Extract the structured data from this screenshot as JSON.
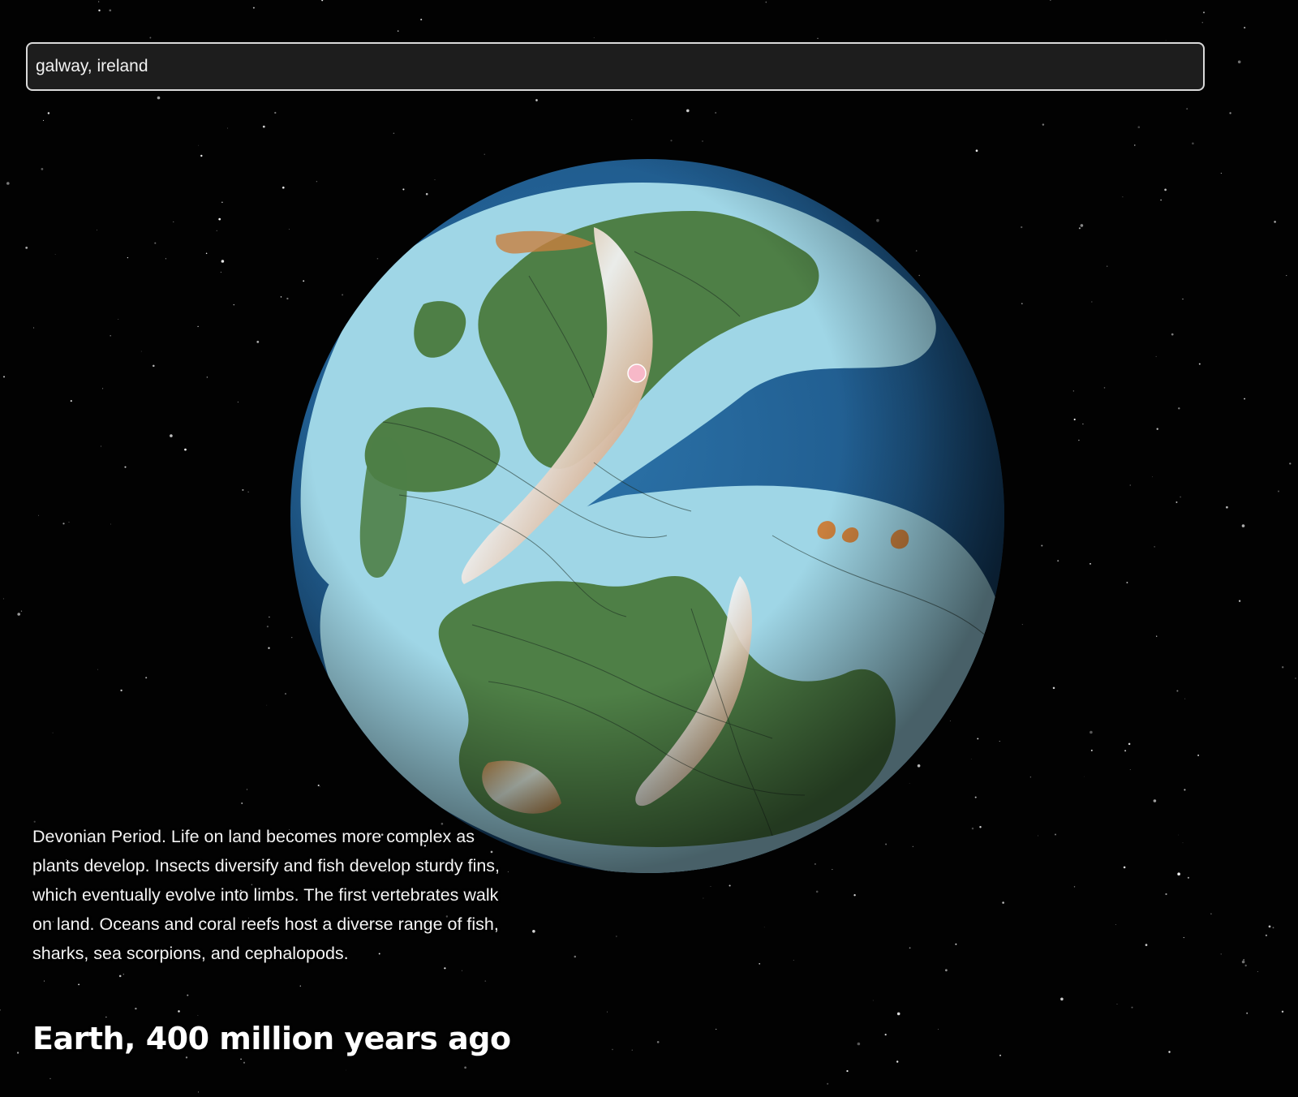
{
  "search": {
    "value": "galway, ireland",
    "placeholder": ""
  },
  "globe": {
    "marker_label": "",
    "colors": {
      "deep_ocean": "#1f5a8c",
      "shallow_shelf": "#9fd6e6",
      "lowland": "#4e7f46",
      "upland": "#c9803e",
      "peak": "#f2f2f2",
      "marker": "#f7b8c8"
    }
  },
  "info": {
    "description": "Devonian Period. Life on land becomes more complex as plants develop. Insects diversify and fish develop sturdy fins, which eventually evolve into limbs. The first vertebrates walk on land. Oceans and coral reefs host a diverse range of fish, sharks, sea scorpions, and cephalopods.",
    "headline": "Earth, 400 million years ago"
  }
}
